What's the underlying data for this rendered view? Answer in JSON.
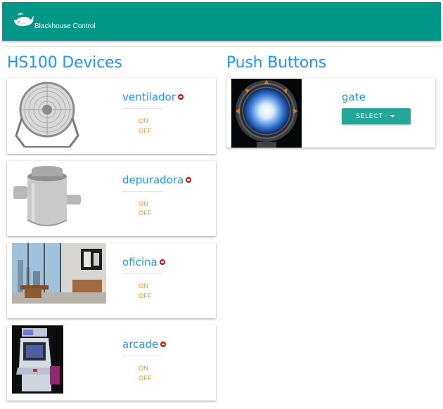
{
  "app": {
    "title": "Blackhouse Control",
    "logo_icon": "whale-icon",
    "bar_color": "#009688"
  },
  "sections": {
    "hs100_title": "HS100 Devices",
    "push_title": "Push Buttons"
  },
  "devices": [
    {
      "name": "ventilador",
      "on_label": "ON",
      "off_label": "OFF",
      "status": "error",
      "image_icon": "fan-image"
    },
    {
      "name": "depuradora",
      "on_label": "ON",
      "off_label": "OFF",
      "status": "error",
      "image_icon": "pool-filter-image"
    },
    {
      "name": "oficina",
      "on_label": "ON",
      "off_label": "OFF",
      "status": "error",
      "image_icon": "office-image"
    },
    {
      "name": "arcade",
      "on_label": "ON",
      "off_label": "OFF",
      "status": "error",
      "image_icon": "arcade-cabinet-image"
    }
  ],
  "push_buttons": [
    {
      "name": "gate",
      "select_label": "SELECT",
      "image_icon": "stargate-image"
    }
  ],
  "colors": {
    "accent": "#2196f3",
    "toggle": "#ff9800",
    "select_button": "#26a69a",
    "status_error": "#d32f2f"
  }
}
